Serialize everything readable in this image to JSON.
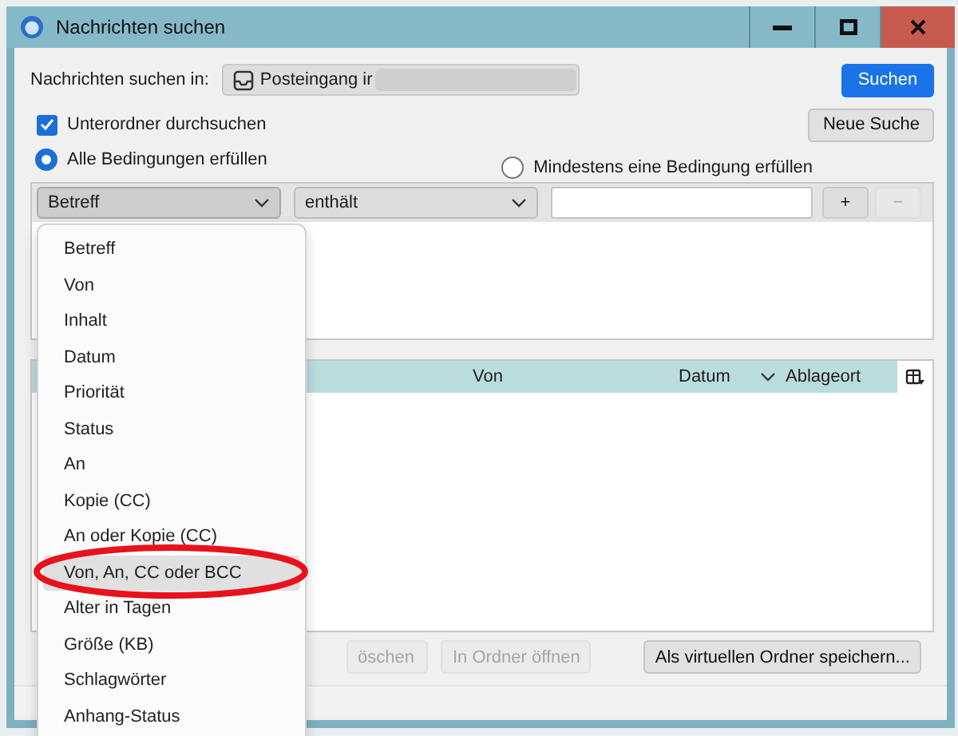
{
  "window": {
    "title": "Nachrichten suchen"
  },
  "search_in": {
    "label": "Nachrichten suchen in:",
    "folder": "Posteingang ir"
  },
  "search_button": "Suchen",
  "subfolders": {
    "label": "Unterordner durchsuchen",
    "checked": true
  },
  "new_search_button": "Neue Suche",
  "match_options": [
    {
      "label": "Alle Bedingungen erfüllen",
      "selected": true
    },
    {
      "label": "Mindestens eine Bedingung erfüllen",
      "selected": false
    }
  ],
  "conditions": [
    {
      "field": "Betreff",
      "operator": "enthält",
      "expanded": true
    }
  ],
  "add_button": {
    "label": "+",
    "disabled": false
  },
  "remove_button": {
    "label": "−",
    "disabled": true
  },
  "results": {
    "columns": [
      {
        "label": "Von",
        "sorted": false
      },
      {
        "label": "Datum",
        "sorted": true
      },
      {
        "label": "Ablageort",
        "sorted": false
      }
    ]
  },
  "actions": [
    {
      "label": "öschen",
      "disabled": true
    },
    {
      "label": "In Ordner öffnen",
      "disabled": true
    },
    {
      "label": "Als virtuellen Ordner speichern...",
      "disabled": false
    }
  ],
  "dropdown": {
    "items": [
      {
        "label": "Betreff",
        "selected": false
      },
      {
        "label": "Von",
        "selected": false
      },
      {
        "label": "Inhalt",
        "selected": false
      },
      {
        "label": "Datum",
        "selected": false
      },
      {
        "label": "Priorität",
        "selected": false
      },
      {
        "label": "Status",
        "selected": false
      },
      {
        "label": "An",
        "selected": false
      },
      {
        "label": "Kopie (CC)",
        "selected": false
      },
      {
        "label": "An oder Kopie (CC)",
        "selected": false
      },
      {
        "label": "Von, An, CC oder BCC",
        "selected": true
      },
      {
        "label": "Alter in Tagen",
        "selected": false
      },
      {
        "label": "Größe (KB)",
        "selected": false
      },
      {
        "label": "Schlagwörter",
        "selected": false
      },
      {
        "label": "Anhang-Status",
        "selected": false
      }
    ]
  }
}
